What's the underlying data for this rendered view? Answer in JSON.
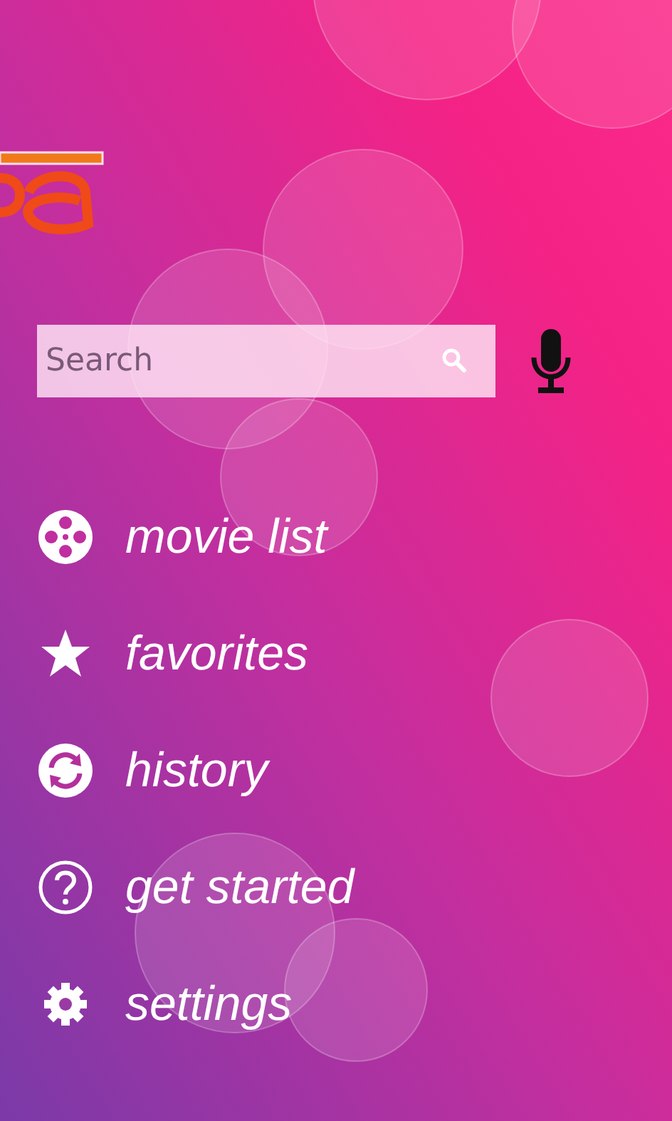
{
  "search": {
    "placeholder": "Search"
  },
  "menu": [
    {
      "label": "movie list",
      "kind": "film"
    },
    {
      "label": "favorites",
      "kind": "star"
    },
    {
      "label": "history",
      "kind": "refresh"
    },
    {
      "label": "get started",
      "kind": "help"
    },
    {
      "label": "settings",
      "kind": "gear"
    }
  ]
}
